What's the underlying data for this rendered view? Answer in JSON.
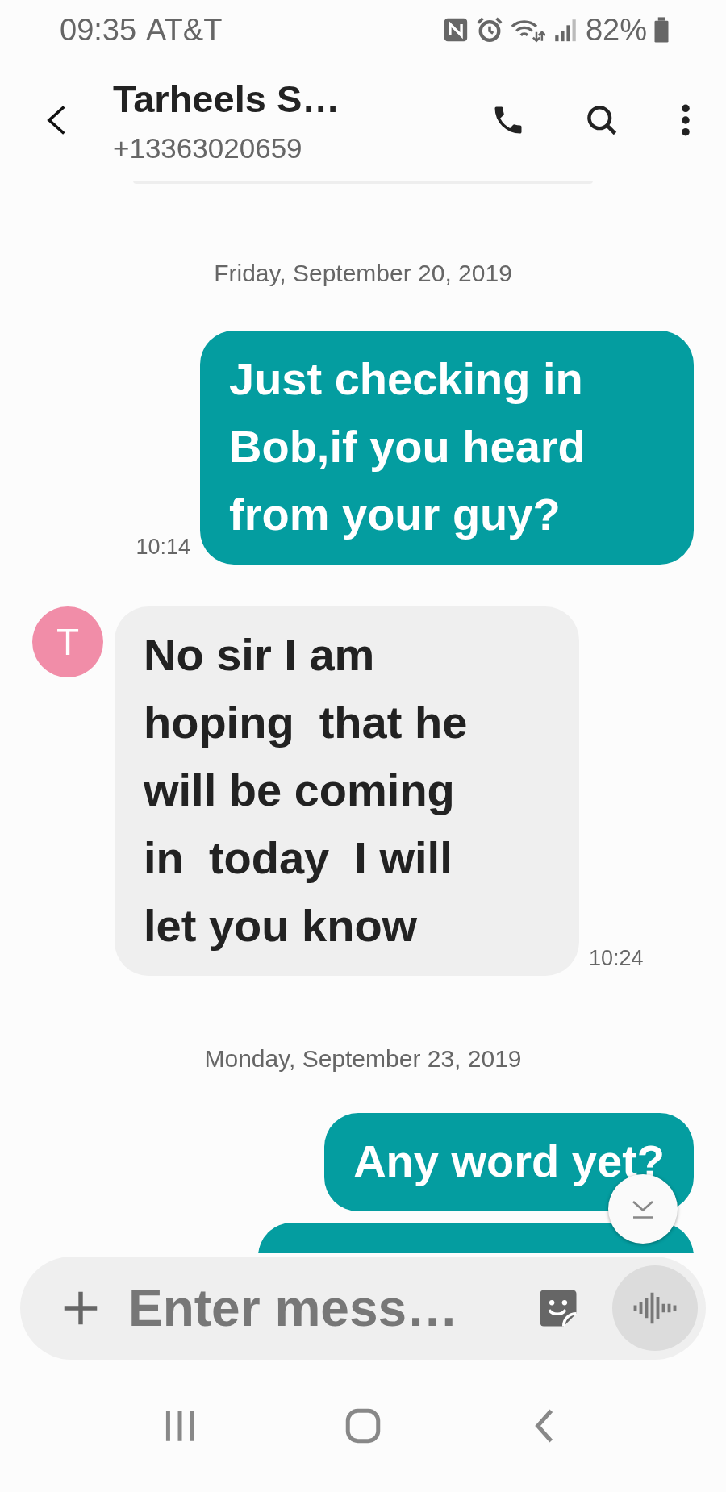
{
  "status_bar": {
    "time": "09:35",
    "carrier": "AT&T",
    "battery": "82%"
  },
  "header": {
    "title": "Tarheels S…",
    "subtitle": "+13363020659"
  },
  "conversation": [
    {
      "kind": "date",
      "text": "Friday, September 20, 2019"
    },
    {
      "kind": "sent",
      "text": "Just checking in Bob,if you heard from your guy?",
      "time": "10:14"
    },
    {
      "kind": "received",
      "avatar": "T",
      "text": "No sir I am hoping  that he will be coming in  today  I will let you know",
      "time": "10:24"
    },
    {
      "kind": "date",
      "text": "Monday, September 23, 2019"
    },
    {
      "kind": "sent",
      "text": "Any word yet?"
    },
    {
      "kind": "sent"
    }
  ],
  "composer": {
    "placeholder": "Enter mess…"
  }
}
